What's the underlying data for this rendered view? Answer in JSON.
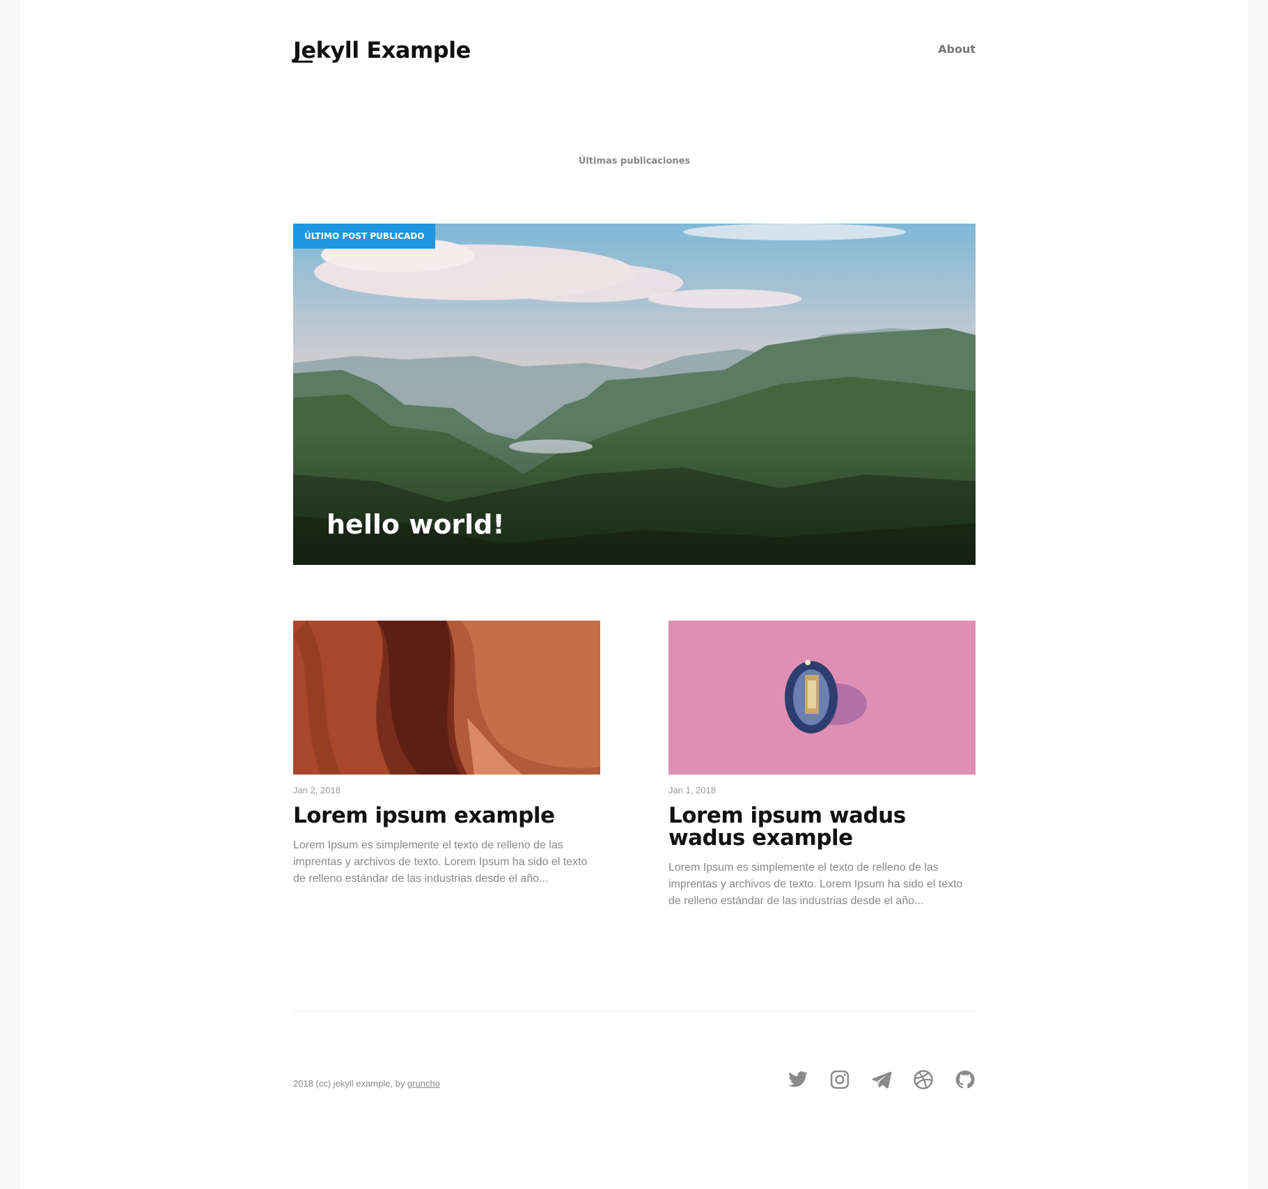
{
  "header": {
    "site_title": "Jekyll Example",
    "nav": [
      {
        "label": "About"
      }
    ]
  },
  "main": {
    "section_label": "Últimas publicaciones",
    "featured": {
      "badge": "ÚLTIMO POST PUBLICADO",
      "title": "hello world!"
    },
    "posts": [
      {
        "date": "Jan 2, 2018",
        "title": "Lorem ipsum example",
        "excerpt": "Lorem Ipsum es simplemente el texto de relleno de las imprentas y archivos de texto. Lorem Ipsum ha sido el texto de relleno estándar de las industrias desde el año..."
      },
      {
        "date": "Jan 1, 2018",
        "title": "Lorem ipsum wadus wadus example",
        "excerpt": "Lorem Ipsum es simplemente el texto de relleno de las imprentas y archivos de texto. Lorem Ipsum ha sido el texto de relleno estándar de las industrias desde el año..."
      }
    ]
  },
  "footer": {
    "copyright": "2018 (cc) jekyll example, by ",
    "author_link": "gruncho",
    "social": [
      {
        "name": "twitter-icon"
      },
      {
        "name": "instagram-icon"
      },
      {
        "name": "telegram-icon"
      },
      {
        "name": "dribbble-icon"
      },
      {
        "name": "github-icon"
      }
    ]
  },
  "colors": {
    "accent": "#1f97e0",
    "text": "#111111",
    "muted": "#888888",
    "background": "#f9f9f9"
  }
}
